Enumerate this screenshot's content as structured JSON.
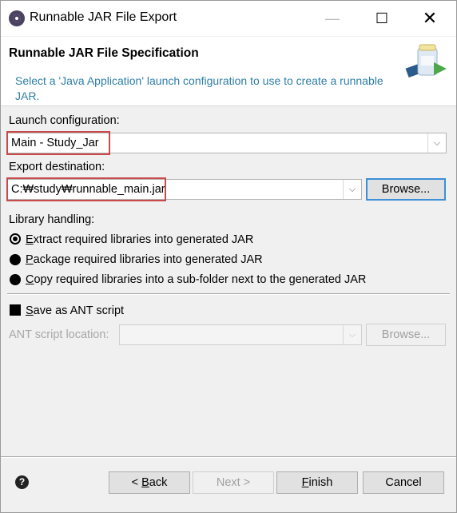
{
  "window": {
    "title": "Runnable JAR File Export",
    "minimize_glyph": "—",
    "maximize_glyph": "☐",
    "close_glyph": "✕"
  },
  "header": {
    "title": "Runnable JAR File Specification",
    "message": "Select a 'Java Application' launch configuration to use to create a runnable JAR."
  },
  "launch": {
    "label": "Launch configuration:",
    "value": "Main - Study_Jar"
  },
  "export": {
    "label": "Export destination:",
    "value": "C:₩study₩runnable_main.jar",
    "browse_label": "Browse..."
  },
  "library": {
    "label": "Library handling:",
    "options": [
      {
        "first": "E",
        "rest": "xtract required libraries into generated JAR",
        "selected": true
      },
      {
        "first": "P",
        "rest": "ackage required libraries into generated JAR",
        "selected": false
      },
      {
        "first": "C",
        "rest": "opy required libraries into a sub-folder next to the generated JAR",
        "selected": false
      }
    ]
  },
  "ant": {
    "checkbox_first": "S",
    "checkbox_rest": "ave as ANT script",
    "checked": false,
    "location_label": "ANT script location:",
    "location_value": "",
    "browse_label": "Browse..."
  },
  "footer": {
    "help_glyph": "?",
    "back_prefix": "< ",
    "back_first": "B",
    "back_rest": "ack",
    "next_label": "Next >",
    "finish_first": "F",
    "finish_rest": "inish",
    "cancel_label": "Cancel"
  },
  "colors": {
    "highlight": "#c94a4a",
    "message": "#2f7fa6",
    "focus": "#3c8fd8"
  }
}
